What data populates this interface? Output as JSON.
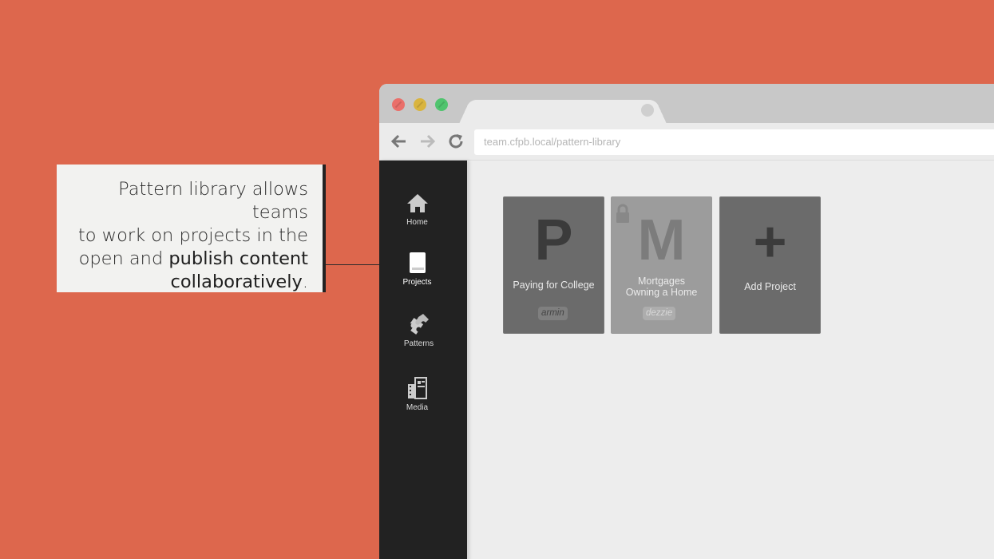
{
  "callout": {
    "line1": "Pattern library allows teams",
    "line2": "to work on projects in the",
    "line3_plain": "open and ",
    "line3_bold": "publish content",
    "line4_bold": "collaboratively",
    "line4_end": "."
  },
  "browser": {
    "url": "team.cfpb.local/pattern-library",
    "window_buttons": [
      "close",
      "minimize",
      "maximize"
    ]
  },
  "sidebar": {
    "items": [
      {
        "label": "Home",
        "icon": "home-icon"
      },
      {
        "label": "Projects",
        "icon": "book-icon",
        "active": true
      },
      {
        "label": "Patterns",
        "icon": "puzzle-icon"
      },
      {
        "label": "Media",
        "icon": "media-icon"
      }
    ]
  },
  "projects": [
    {
      "letter": "P",
      "title": "Paying for College",
      "owner": "armin"
    },
    {
      "letter": "M",
      "title_line1": "Mortgages",
      "title_line2": "Owning a Home",
      "owner": "dezzie",
      "locked": true
    },
    {
      "letter": "+",
      "title": "Add Project"
    }
  ],
  "colors": {
    "background": "#dd674d",
    "sidebar": "#222222",
    "card": "#6b6b6b",
    "card_locked": "#9c9c9c"
  }
}
